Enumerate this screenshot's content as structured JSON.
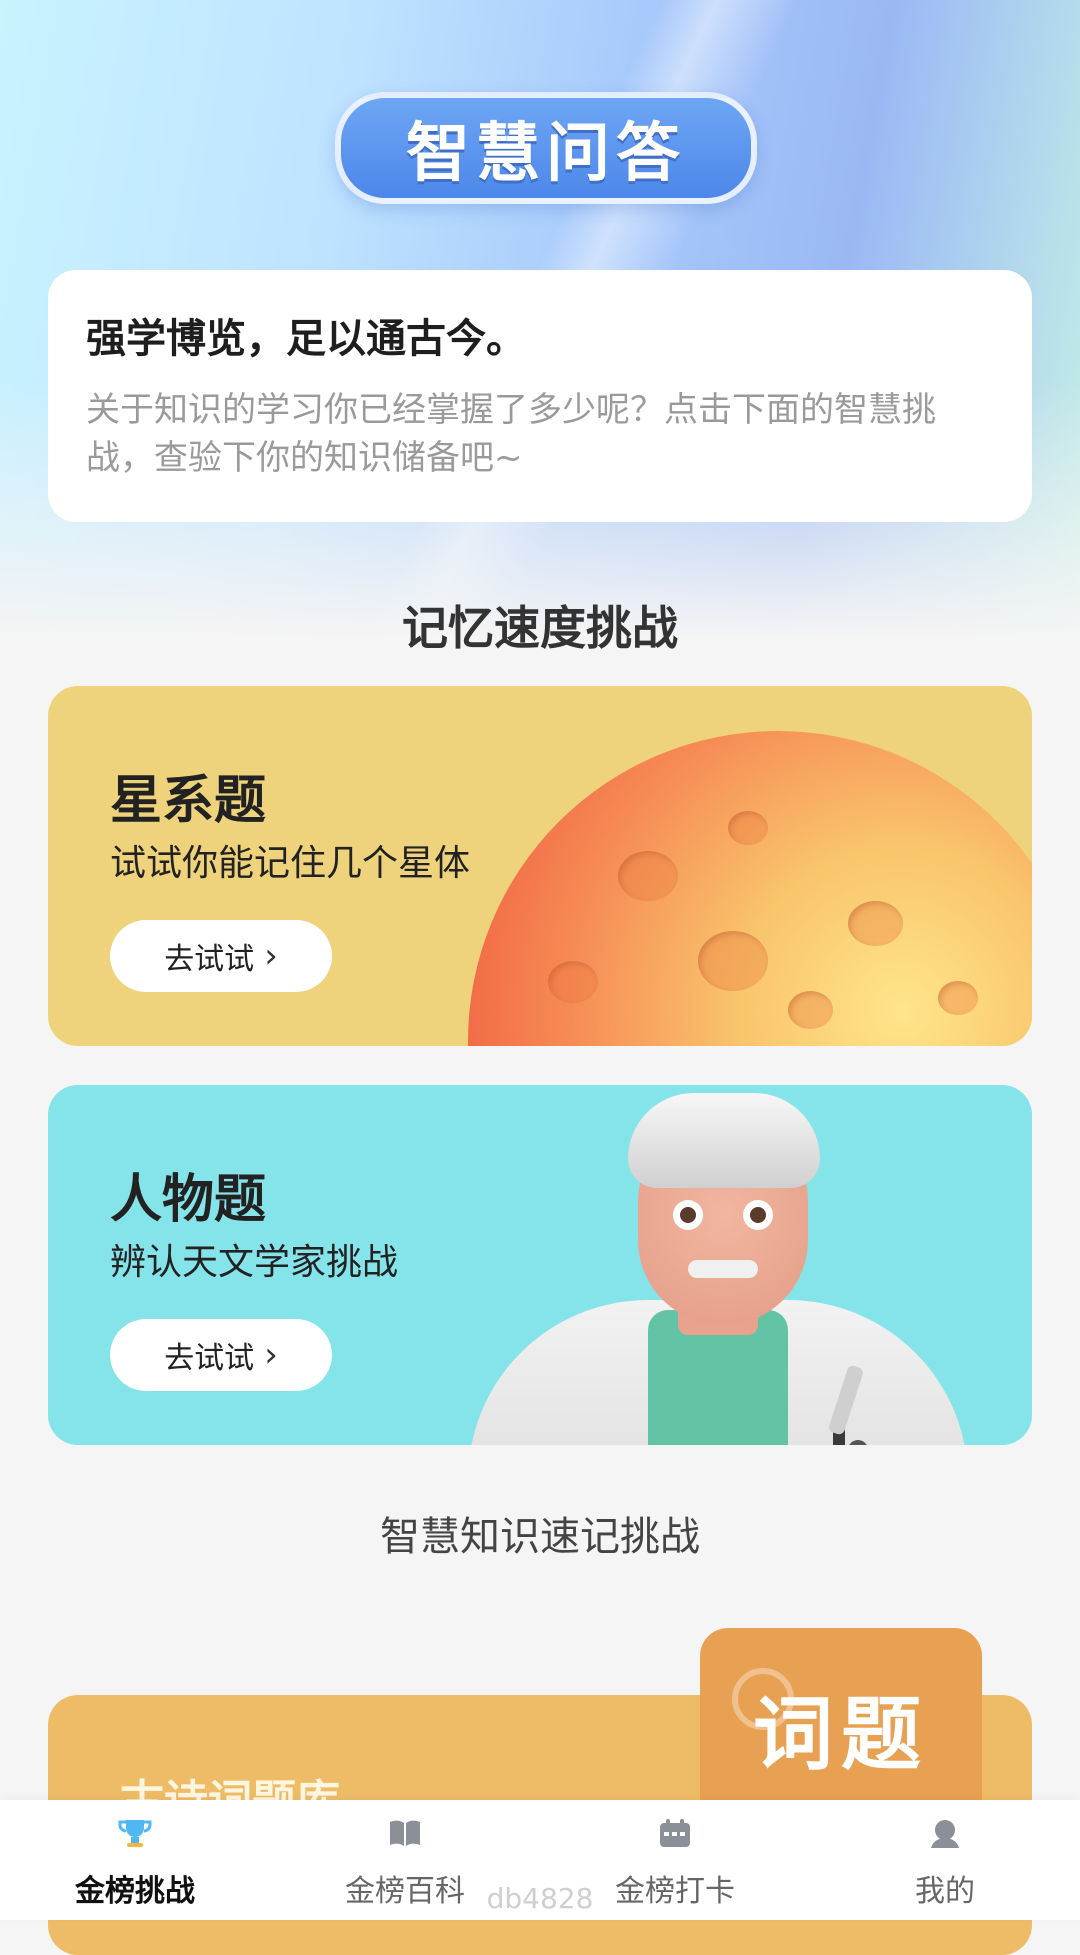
{
  "header": {
    "title": "智慧问答"
  },
  "intro": {
    "heading": "强学博览，足以通古今。",
    "body": "关于知识的学习你已经掌握了多少呢？点击下面的智慧挑战，查验下你的知识储备吧~"
  },
  "sections": {
    "memory": "记忆速度挑战",
    "knowledge": "智慧知识速记挑战"
  },
  "cards": [
    {
      "title": "星系题",
      "subtitle": "试试你能记住几个星体",
      "button": "去试试"
    },
    {
      "title": "人物题",
      "subtitle": "辨认天文学家挑战",
      "button": "去试试"
    }
  ],
  "poem_card": {
    "title": "古诗词题库",
    "badge": "词题"
  },
  "tabs": [
    {
      "label": "金榜挑战",
      "icon": "trophy-icon",
      "active": true
    },
    {
      "label": "金榜百科",
      "icon": "book-icon",
      "active": false
    },
    {
      "label": "金榜打卡",
      "icon": "calendar-icon",
      "active": false
    },
    {
      "label": "我的",
      "icon": "user-icon",
      "active": false
    }
  ],
  "watermark": "db4828",
  "colors": {
    "accent": "#4d87ea",
    "star_card": "#eed27c",
    "person_card": "#85e3ea",
    "poem_card": "#eebc67"
  }
}
